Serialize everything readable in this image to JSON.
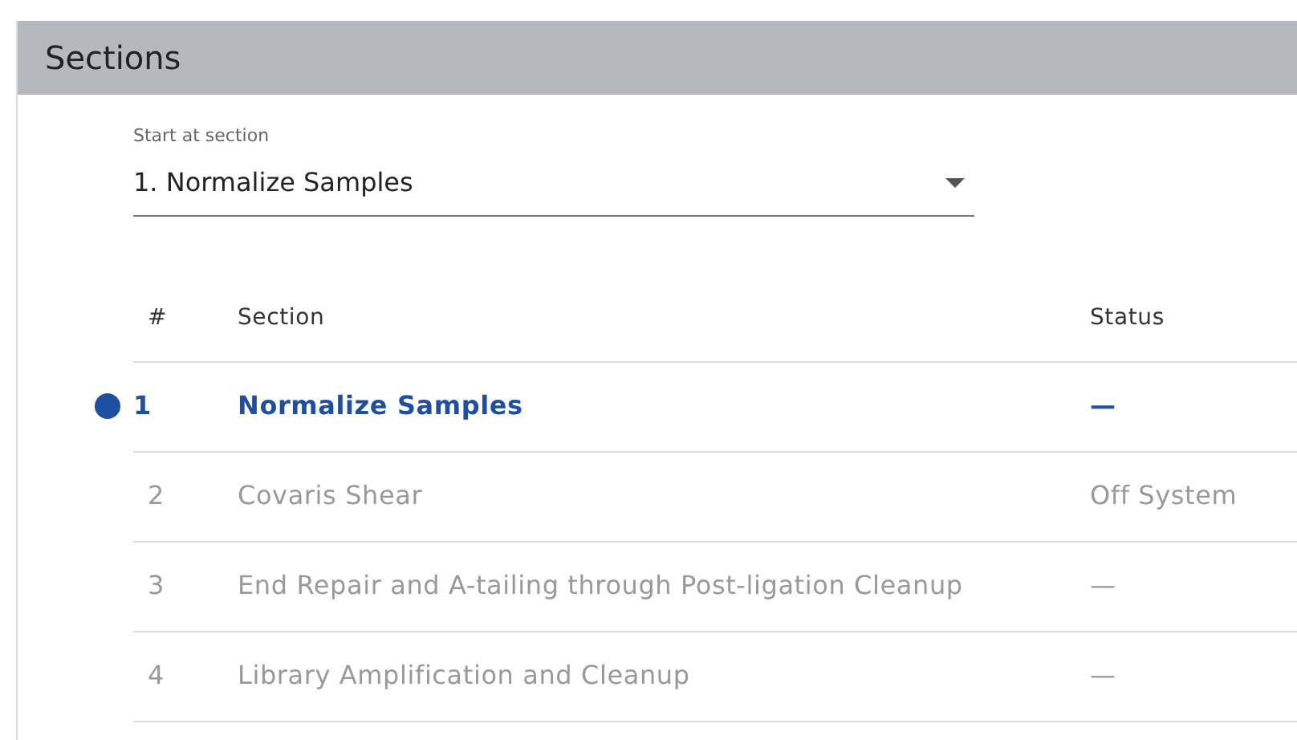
{
  "header": {
    "title": "Sections"
  },
  "start_field": {
    "label": "Start at section",
    "value": "1. Normalize Samples"
  },
  "table": {
    "columns": [
      "#",
      "Section",
      "Status"
    ],
    "rows": [
      {
        "number": "1",
        "section": "Normalize Samples",
        "status": "—",
        "selected": true
      },
      {
        "number": "2",
        "section": "Covaris Shear",
        "status": "Off System",
        "selected": false
      },
      {
        "number": "3",
        "section": "End Repair and A-tailing through Post-ligation Cleanup",
        "status": "—",
        "selected": false
      },
      {
        "number": "4",
        "section": "Library Amplification and Cleanup",
        "status": "—",
        "selected": false
      }
    ]
  }
}
